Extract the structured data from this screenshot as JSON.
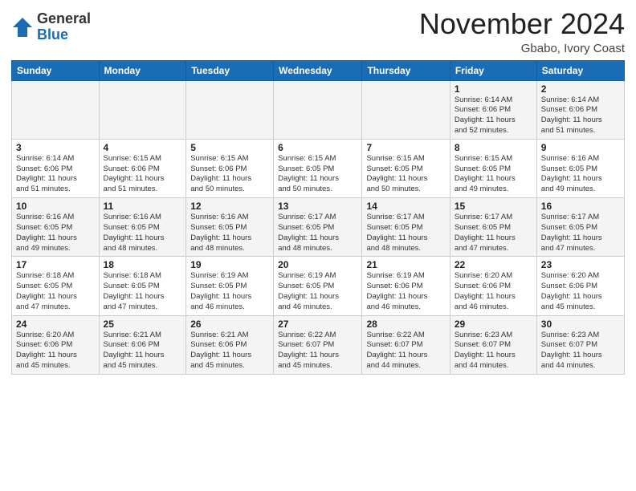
{
  "header": {
    "logo_general": "General",
    "logo_blue": "Blue",
    "month_title": "November 2024",
    "location": "Gbabo, Ivory Coast"
  },
  "weekdays": [
    "Sunday",
    "Monday",
    "Tuesday",
    "Wednesday",
    "Thursday",
    "Friday",
    "Saturday"
  ],
  "weeks": [
    [
      {
        "day": "",
        "info": ""
      },
      {
        "day": "",
        "info": ""
      },
      {
        "day": "",
        "info": ""
      },
      {
        "day": "",
        "info": ""
      },
      {
        "day": "",
        "info": ""
      },
      {
        "day": "1",
        "info": "Sunrise: 6:14 AM\nSunset: 6:06 PM\nDaylight: 11 hours\nand 52 minutes."
      },
      {
        "day": "2",
        "info": "Sunrise: 6:14 AM\nSunset: 6:06 PM\nDaylight: 11 hours\nand 51 minutes."
      }
    ],
    [
      {
        "day": "3",
        "info": "Sunrise: 6:14 AM\nSunset: 6:06 PM\nDaylight: 11 hours\nand 51 minutes."
      },
      {
        "day": "4",
        "info": "Sunrise: 6:15 AM\nSunset: 6:06 PM\nDaylight: 11 hours\nand 51 minutes."
      },
      {
        "day": "5",
        "info": "Sunrise: 6:15 AM\nSunset: 6:06 PM\nDaylight: 11 hours\nand 50 minutes."
      },
      {
        "day": "6",
        "info": "Sunrise: 6:15 AM\nSunset: 6:05 PM\nDaylight: 11 hours\nand 50 minutes."
      },
      {
        "day": "7",
        "info": "Sunrise: 6:15 AM\nSunset: 6:05 PM\nDaylight: 11 hours\nand 50 minutes."
      },
      {
        "day": "8",
        "info": "Sunrise: 6:15 AM\nSunset: 6:05 PM\nDaylight: 11 hours\nand 49 minutes."
      },
      {
        "day": "9",
        "info": "Sunrise: 6:16 AM\nSunset: 6:05 PM\nDaylight: 11 hours\nand 49 minutes."
      }
    ],
    [
      {
        "day": "10",
        "info": "Sunrise: 6:16 AM\nSunset: 6:05 PM\nDaylight: 11 hours\nand 49 minutes."
      },
      {
        "day": "11",
        "info": "Sunrise: 6:16 AM\nSunset: 6:05 PM\nDaylight: 11 hours\nand 48 minutes."
      },
      {
        "day": "12",
        "info": "Sunrise: 6:16 AM\nSunset: 6:05 PM\nDaylight: 11 hours\nand 48 minutes."
      },
      {
        "day": "13",
        "info": "Sunrise: 6:17 AM\nSunset: 6:05 PM\nDaylight: 11 hours\nand 48 minutes."
      },
      {
        "day": "14",
        "info": "Sunrise: 6:17 AM\nSunset: 6:05 PM\nDaylight: 11 hours\nand 48 minutes."
      },
      {
        "day": "15",
        "info": "Sunrise: 6:17 AM\nSunset: 6:05 PM\nDaylight: 11 hours\nand 47 minutes."
      },
      {
        "day": "16",
        "info": "Sunrise: 6:17 AM\nSunset: 6:05 PM\nDaylight: 11 hours\nand 47 minutes."
      }
    ],
    [
      {
        "day": "17",
        "info": "Sunrise: 6:18 AM\nSunset: 6:05 PM\nDaylight: 11 hours\nand 47 minutes."
      },
      {
        "day": "18",
        "info": "Sunrise: 6:18 AM\nSunset: 6:05 PM\nDaylight: 11 hours\nand 47 minutes."
      },
      {
        "day": "19",
        "info": "Sunrise: 6:19 AM\nSunset: 6:05 PM\nDaylight: 11 hours\nand 46 minutes."
      },
      {
        "day": "20",
        "info": "Sunrise: 6:19 AM\nSunset: 6:05 PM\nDaylight: 11 hours\nand 46 minutes."
      },
      {
        "day": "21",
        "info": "Sunrise: 6:19 AM\nSunset: 6:06 PM\nDaylight: 11 hours\nand 46 minutes."
      },
      {
        "day": "22",
        "info": "Sunrise: 6:20 AM\nSunset: 6:06 PM\nDaylight: 11 hours\nand 46 minutes."
      },
      {
        "day": "23",
        "info": "Sunrise: 6:20 AM\nSunset: 6:06 PM\nDaylight: 11 hours\nand 45 minutes."
      }
    ],
    [
      {
        "day": "24",
        "info": "Sunrise: 6:20 AM\nSunset: 6:06 PM\nDaylight: 11 hours\nand 45 minutes."
      },
      {
        "day": "25",
        "info": "Sunrise: 6:21 AM\nSunset: 6:06 PM\nDaylight: 11 hours\nand 45 minutes."
      },
      {
        "day": "26",
        "info": "Sunrise: 6:21 AM\nSunset: 6:06 PM\nDaylight: 11 hours\nand 45 minutes."
      },
      {
        "day": "27",
        "info": "Sunrise: 6:22 AM\nSunset: 6:07 PM\nDaylight: 11 hours\nand 45 minutes."
      },
      {
        "day": "28",
        "info": "Sunrise: 6:22 AM\nSunset: 6:07 PM\nDaylight: 11 hours\nand 44 minutes."
      },
      {
        "day": "29",
        "info": "Sunrise: 6:23 AM\nSunset: 6:07 PM\nDaylight: 11 hours\nand 44 minutes."
      },
      {
        "day": "30",
        "info": "Sunrise: 6:23 AM\nSunset: 6:07 PM\nDaylight: 11 hours\nand 44 minutes."
      }
    ]
  ]
}
